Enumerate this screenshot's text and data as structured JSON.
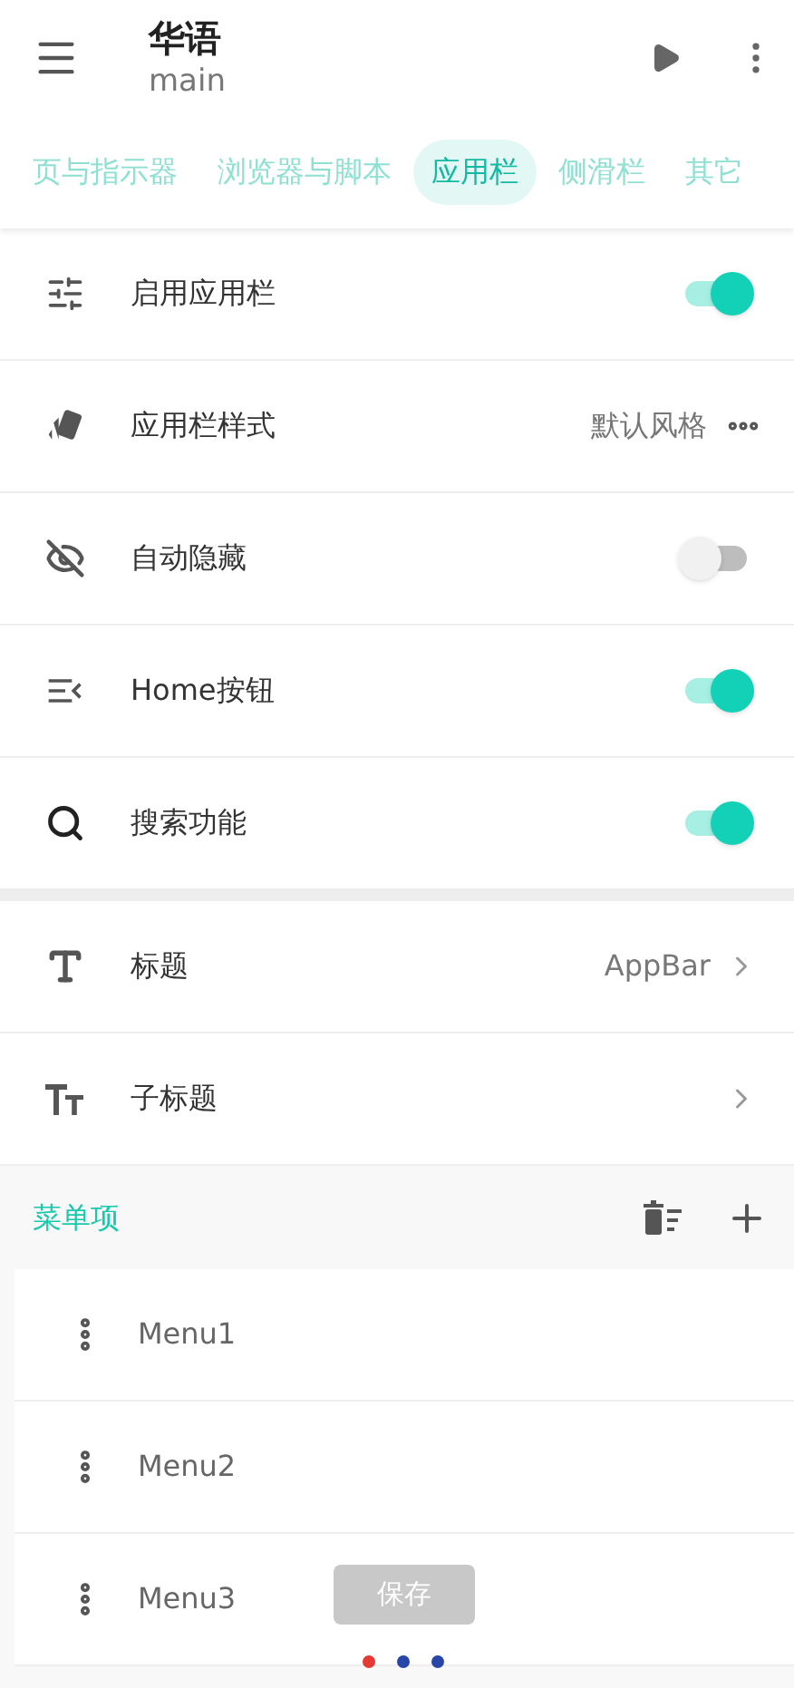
{
  "app_bar": {
    "title": "华语",
    "subtitle": "main"
  },
  "tabs": [
    {
      "label": "页与指示器",
      "selected": false
    },
    {
      "label": "浏览器与脚本",
      "selected": false
    },
    {
      "label": "应用栏",
      "selected": true
    },
    {
      "label": "侧滑栏",
      "selected": false
    },
    {
      "label": "其它",
      "selected": false
    }
  ],
  "settings": [
    {
      "kind": "toggle",
      "label": "启用应用栏",
      "on": true
    },
    {
      "kind": "value",
      "label": "应用栏样式",
      "value": "默认风格"
    },
    {
      "kind": "toggle",
      "label": "自动隐藏",
      "on": false
    },
    {
      "kind": "toggle",
      "label": "Home按钮",
      "on": true
    },
    {
      "kind": "toggle",
      "label": "搜索功能",
      "on": true
    }
  ],
  "text_settings": [
    {
      "label": "标题",
      "value": "AppBar"
    },
    {
      "label": "子标题"
    }
  ],
  "menu_section": {
    "title": "菜单项",
    "items": [
      "Menu1",
      "Menu2",
      "Menu3"
    ]
  },
  "save_button": "保存",
  "page_dots": [
    {
      "color": "#e53935"
    },
    {
      "color": "#2746a8"
    },
    {
      "color": "#2746a8"
    }
  ]
}
